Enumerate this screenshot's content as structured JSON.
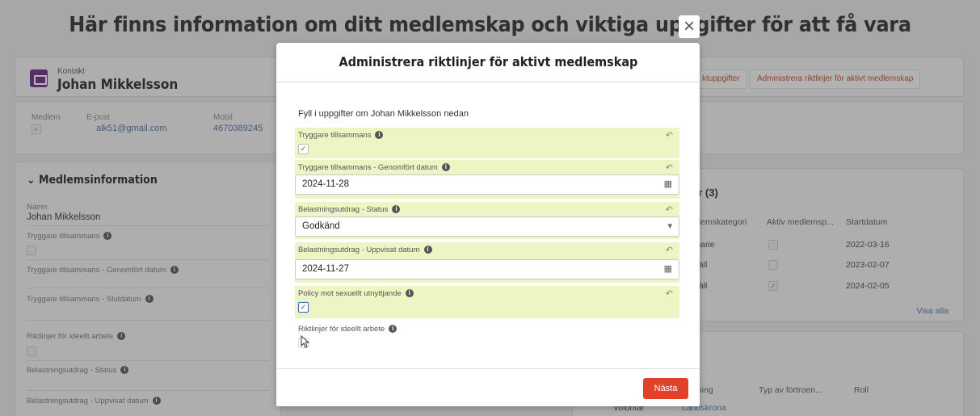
{
  "banner": {
    "text": "Här finns information om ditt medlemskap och viktiga uppgifter för att få vara volontär inom Rädda Barnen."
  },
  "record": {
    "type": "Kontakt",
    "name": "Johan Mikkelsson"
  },
  "header_actions": [
    "ktuppgifter",
    "Administrera riktlinjer för aktivt medlemskap"
  ],
  "highlights": {
    "member_label": "Medlem",
    "member_checked": true,
    "email_label": "E-post",
    "email_value": "alk51@gmail.com",
    "mobile_label": "Mobil",
    "mobile_value": "4670389245"
  },
  "left_section": {
    "title": "Medlemsinformation",
    "name_label": "Namn",
    "name_value": "Johan Mikkelsson",
    "fields": [
      "Tryggare tillsammans",
      "Tryggare tillsammans - Genomfört datum",
      "Tryggare tillsammans - Slutdatum",
      "Riktlinjer för ideellt arbete",
      "Belastningsutdrag - Status",
      "Belastningsutdrag - Uppvisat datum"
    ]
  },
  "memberships_card": {
    "title": "er (3)",
    "headers": [
      "dlemskategori",
      "Aktiv medlemsp...",
      "Startdatum"
    ],
    "rows": [
      {
        "category": "inarie",
        "active": false,
        "start": "2022-03-16"
      },
      {
        "category": "häll",
        "active": false,
        "start": "2023-02-07"
      },
      {
        "category": "häll",
        "active": true,
        "start": "2024-02-05"
      }
    ],
    "view_all": "Visa alla"
  },
  "roles_card": {
    "title": "",
    "headers": [
      "ening",
      "Typ av förtroen...",
      "Roll"
    ],
    "row": [
      "Volontär",
      "Landskrona"
    ]
  },
  "modal": {
    "title": "Administrera riktlinjer för aktivt medlemskap",
    "close_icon": "close-icon",
    "intro": "Fyll i uppgifter om Johan Mikkelsson nedan",
    "f1_label": "Tryggare tillsammans",
    "f1_checked": true,
    "f2_label": "Tryggare tillsammans - Genomfört datum",
    "f2_value": "2024-11-28",
    "f3_label": "Belastningsutdrag - Status",
    "f3_value": "Godkänd",
    "f4_label": "Belastningsutdrag - Uppvisat datum",
    "f4_value": "2024-11-27",
    "f5_label": "Policy mot sexuellt utnyttjande",
    "f5_checked": true,
    "f6_label": "Riktlinjer för ideellt arbete",
    "f6_checked": false,
    "next_button": "Nästa",
    "highlight_color": "#eef5c5",
    "accent_color": "#e0422a"
  }
}
